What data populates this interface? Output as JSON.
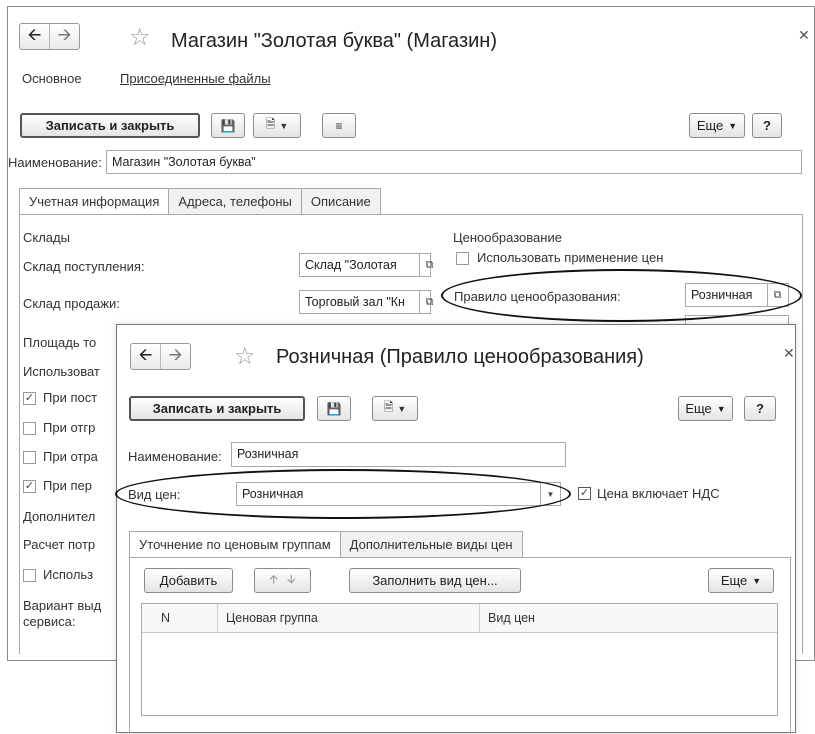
{
  "back_window": {
    "title": "Магазин \"Золотая буква\" (Магазин)",
    "nav_tabs": [
      "Основное",
      "Присоединенные файлы"
    ],
    "toolbar": {
      "save_close": "Записать и закрыть",
      "more": "Еще",
      "help": "?"
    },
    "name_label": "Наименование:",
    "name_value": "Магазин \"Золотая буква\"",
    "tabs": [
      "Учетная информация",
      "Адреса, телефоны",
      "Описание"
    ],
    "warehouses_header": "Склады",
    "receipt_label": "Склад поступления:",
    "receipt_value": "Склад \"Золотая",
    "sales_label": "Склад продажи:",
    "sales_value": "Торговый зал \"Кн",
    "area_label": "Площадь то",
    "use_label": "Использоват",
    "checks": [
      {
        "label": "При пост",
        "checked": true
      },
      {
        "label": "При отгр",
        "checked": false
      },
      {
        "label": "При отра",
        "checked": false
      },
      {
        "label": "При пер",
        "checked": true
      }
    ],
    "extra_label": "Дополнител",
    "calc_label": "Расчет потр",
    "use2_label": "Использ",
    "variant_label": "Вариант выд",
    "service_label": "сервиса:",
    "pricing_header": "Ценообразование",
    "pricing_use_label": "Использовать применение цен",
    "pricing_rule_label": "Правило ценообразования:",
    "pricing_rule_value": "Розничная"
  },
  "front_window": {
    "title": "Розничная (Правило ценообразования)",
    "toolbar": {
      "save_close": "Записать и закрыть",
      "more": "Еще",
      "help": "?"
    },
    "name_label": "Наименование:",
    "name_value": "Розничная",
    "price_type_label": "Вид цен:",
    "price_type_value": "Розничная",
    "vat_label": "Цена включает НДС",
    "vat_checked": true,
    "tabs": [
      "Уточнение по ценовым группам",
      "Дополнительные виды цен"
    ],
    "grid_toolbar": {
      "add": "Добавить",
      "fill": "Заполнить вид цен...",
      "more": "Еще"
    },
    "columns": [
      "N",
      "Ценовая группа",
      "Вид цен"
    ]
  },
  "icons": {
    "back": "arrow-left-icon",
    "forward": "arrow-right-icon",
    "favorite": "star-icon",
    "close": "close-icon",
    "save": "floppy-disk-icon",
    "report": "document-arrow-icon",
    "list": "list-icon",
    "open": "open-window-icon",
    "dropdown": "chevron-down-icon",
    "move_up": "arrow-up-icon",
    "move_down": "arrow-down-icon"
  }
}
